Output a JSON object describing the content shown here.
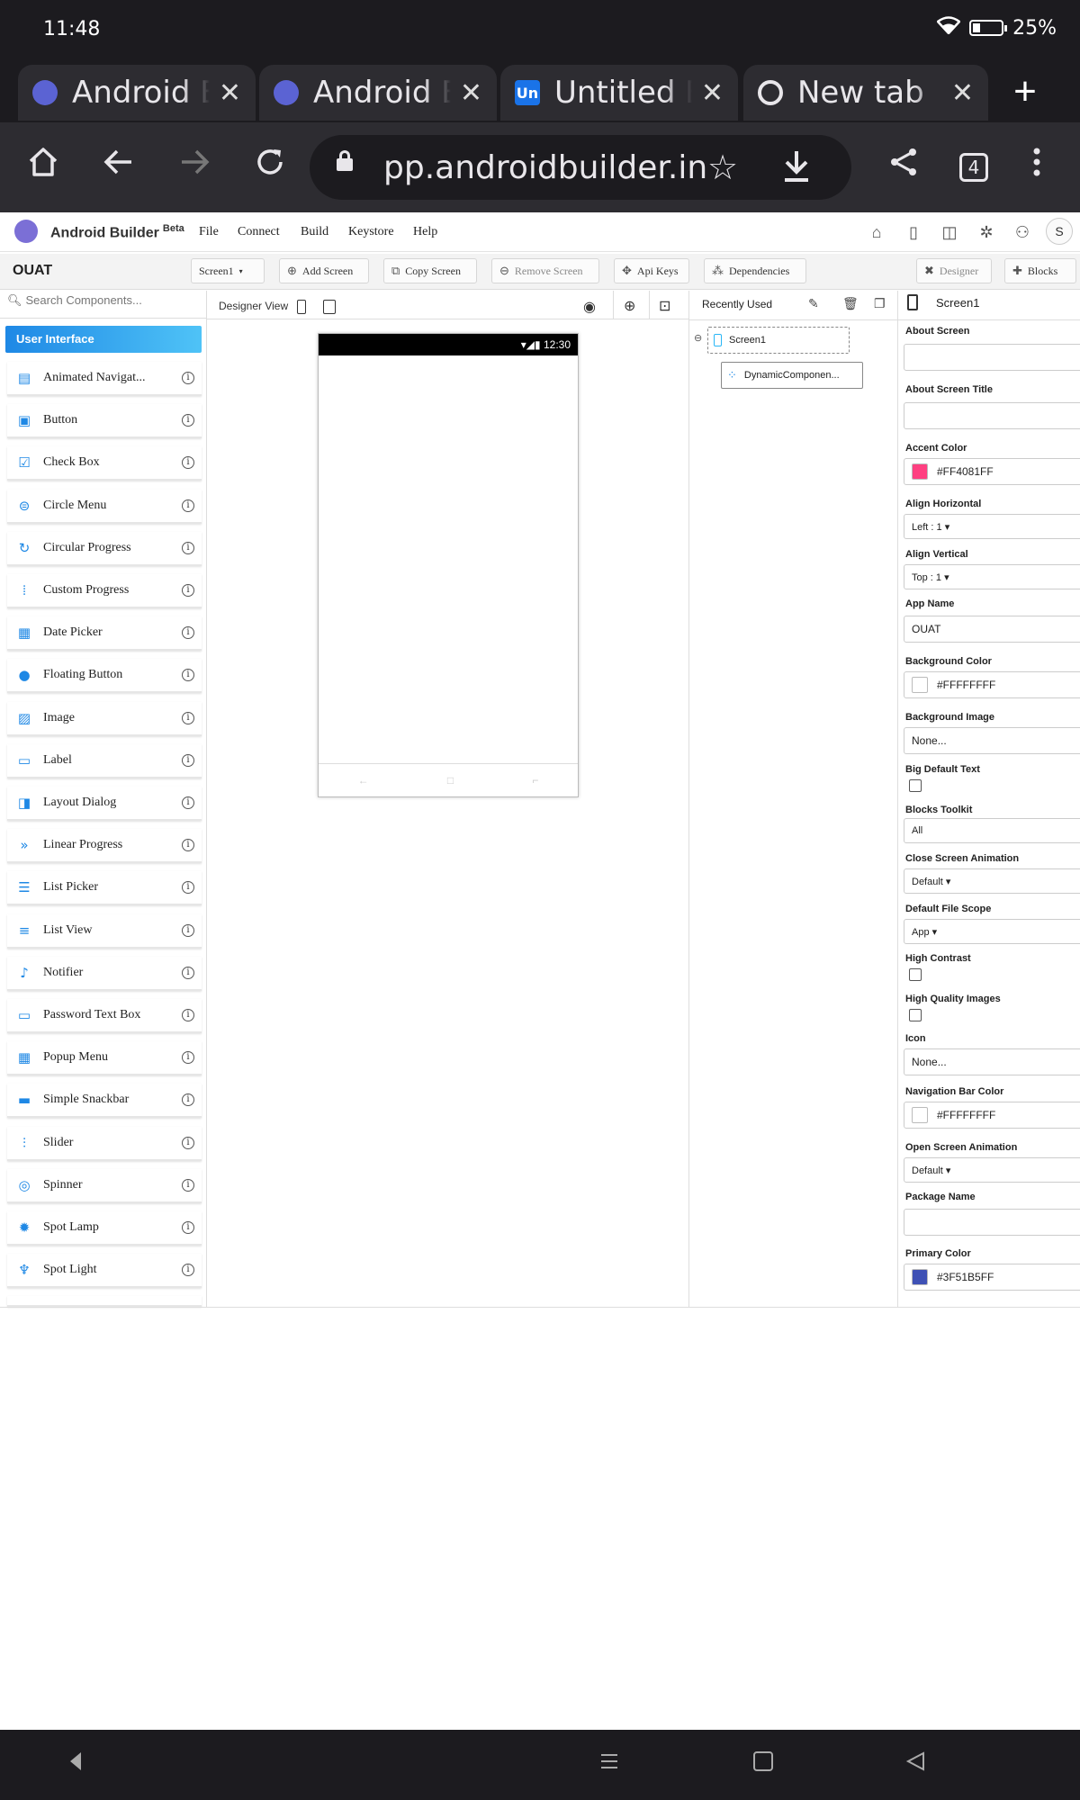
{
  "status": {
    "time": "11:48",
    "battery": "25%",
    "battery_level": 0.25
  },
  "browser": {
    "tabs": [
      {
        "title": "Android Builder",
        "icon": "android-builder-favicon-icon"
      },
      {
        "title": "Android Builder",
        "icon": "android-builder-favicon-icon"
      },
      {
        "title": "Untitled Board",
        "icon": "un-favicon-icon",
        "icon_text": "Un"
      },
      {
        "title": "New tab",
        "icon": "chrome-icon"
      }
    ],
    "url": "pp.androidbuilder.in",
    "tab_count": "4"
  },
  "app": {
    "brand": "Android Builder",
    "beta": "Beta",
    "menu": [
      "File",
      "Connect",
      "Build",
      "Keystore",
      "Help"
    ],
    "avatar": "S",
    "project": "OUAT",
    "screen_select": "Screen1",
    "buttons": {
      "add_screen": "Add Screen",
      "copy_screen": "Copy Screen",
      "remove_screen": "Remove Screen",
      "api_keys": "Api Keys",
      "dependencies": "Dependencies",
      "designer": "Designer",
      "blocks": "Blocks"
    }
  },
  "palette": {
    "search_placeholder": "Search Components...",
    "category": "User Interface",
    "items": [
      {
        "label": "Animated Navigat...",
        "icon": "list-box-icon"
      },
      {
        "label": "Button",
        "icon": "button-square-icon"
      },
      {
        "label": "Check Box",
        "icon": "checkbox-icon"
      },
      {
        "label": "Circle Menu",
        "icon": "circle-menu-icon"
      },
      {
        "label": "Circular Progress",
        "icon": "circular-progress-icon"
      },
      {
        "label": "Custom Progress",
        "icon": "custom-progress-icon"
      },
      {
        "label": "Date Picker",
        "icon": "calendar-icon"
      },
      {
        "label": "Floating Button",
        "icon": "floating-button-icon"
      },
      {
        "label": "Image",
        "icon": "image-icon"
      },
      {
        "label": "Label",
        "icon": "label-icon"
      },
      {
        "label": "Layout Dialog",
        "icon": "layout-dialog-icon"
      },
      {
        "label": "Linear Progress",
        "icon": "linear-progress-icon"
      },
      {
        "label": "List Picker",
        "icon": "list-picker-icon"
      },
      {
        "label": "List View",
        "icon": "list-view-icon"
      },
      {
        "label": "Notifier",
        "icon": "bell-icon"
      },
      {
        "label": "Password Text Box",
        "icon": "password-box-icon"
      },
      {
        "label": "Popup Menu",
        "icon": "popup-menu-icon"
      },
      {
        "label": "Simple Snackbar",
        "icon": "snackbar-icon"
      },
      {
        "label": "Slider",
        "icon": "slider-icon"
      },
      {
        "label": "Spinner",
        "icon": "spinner-icon"
      },
      {
        "label": "Spot Lamp",
        "icon": "lamp-icon"
      },
      {
        "label": "Spot Light",
        "icon": "spotlight-icon"
      }
    ]
  },
  "viewer": {
    "label": "Designer View",
    "phone_time": "12:30"
  },
  "tree": {
    "title": "Recently Used",
    "nodes": [
      "Screen1",
      "DynamicComponen..."
    ]
  },
  "properties": {
    "screen": "Screen1",
    "fields": {
      "about_screen": "About Screen",
      "about_screen_title": "About Screen Title",
      "accent_color": "Accent Color",
      "accent_color_value": "#FF4081FF",
      "align_horizontal": "Align Horizontal",
      "align_horizontal_value": "Left : 1 ▾",
      "align_vertical": "Align Vertical",
      "align_vertical_value": "Top : 1 ▾",
      "app_name": "App Name",
      "app_name_value": "OUAT",
      "background_color": "Background Color",
      "background_color_value": "#FFFFFFFF",
      "background_image": "Background Image",
      "background_image_value": "None...",
      "big_default_text": "Big Default Text",
      "blocks_toolkit": "Blocks Toolkit",
      "blocks_toolkit_value": "All",
      "close_screen_animation": "Close Screen Animation",
      "close_screen_animation_value": "Default ▾",
      "default_file_scope": "Default File Scope",
      "default_file_scope_value": "App ▾",
      "high_contrast": "High Contrast",
      "high_quality_images": "High Quality Images",
      "icon": "Icon",
      "icon_value": "None...",
      "navigation_bar_color": "Navigation Bar Color",
      "navigation_bar_color_value": "#FFFFFFFF",
      "open_screen_animation": "Open Screen Animation",
      "open_screen_animation_value": "Default ▾",
      "package_name": "Package Name",
      "primary_color": "Primary Color",
      "primary_color_value": "#3F51B5FF"
    }
  },
  "colors": {
    "accent": "#FF4081",
    "primary": "#3F51B5",
    "white": "#FFFFFF",
    "header_blue": "#1E88E5"
  }
}
